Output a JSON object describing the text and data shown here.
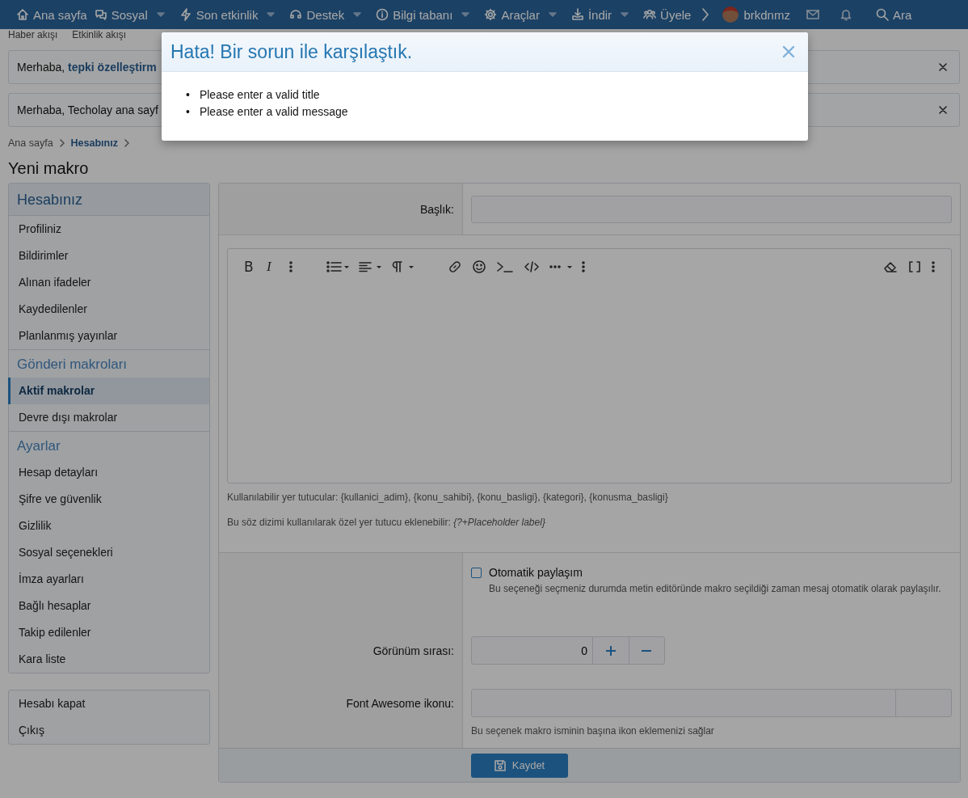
{
  "nav": {
    "items": [
      {
        "label": "Ana sayfa",
        "has_menu": false
      },
      {
        "label": "Sosyal",
        "has_menu": true
      },
      {
        "label": "Son etkinlik",
        "has_menu": true
      },
      {
        "label": "Destek",
        "has_menu": true
      },
      {
        "label": "Bilgi tabanı",
        "has_menu": true
      },
      {
        "label": "Araçlar",
        "has_menu": true
      },
      {
        "label": "İndir",
        "has_menu": true
      },
      {
        "label": "Üyele",
        "has_menu": false
      }
    ],
    "user": {
      "name": "brkdnmz"
    },
    "search": "Ara"
  },
  "subnav": [
    "Haber akışı",
    "Etkinlik akışı"
  ],
  "notices": [
    {
      "text": "Merhaba, **tepki özelleştirm**"
    },
    {
      "text": "Merhaba, Techolay ana sayf"
    }
  ],
  "breadcrumb": [
    {
      "label": "Ana sayfa",
      "current": false
    },
    {
      "label": "Hesabınız",
      "current": true
    }
  ],
  "page_title": "Yeni makro",
  "sidebar": {
    "sections": [
      {
        "title": "Hesabınız",
        "items": [
          {
            "label": "Profiliniz",
            "selected": false
          },
          {
            "label": "Bildirimler",
            "selected": false
          },
          {
            "label": "Alınan ifadeler",
            "selected": false
          },
          {
            "label": "Kaydedilenler",
            "selected": false
          },
          {
            "label": "Planlanmış yayınlar",
            "selected": false
          }
        ]
      },
      {
        "title": "Gönderi makroları",
        "items": [
          {
            "label": "Aktif makrolar",
            "selected": true
          },
          {
            "label": "Devre dışı makrolar",
            "selected": false
          }
        ]
      },
      {
        "title": "Ayarlar",
        "items": [
          {
            "label": "Hesap detayları",
            "selected": false
          },
          {
            "label": "Şifre ve güvenlik",
            "selected": false
          },
          {
            "label": "Gizlilik",
            "selected": false
          },
          {
            "label": "Sosyal seçenekleri",
            "selected": false
          },
          {
            "label": "İmza ayarları",
            "selected": false
          },
          {
            "label": "Bağlı hesaplar",
            "selected": false
          },
          {
            "label": "Takip edilenler",
            "selected": false
          },
          {
            "label": "Kara liste",
            "selected": false
          }
        ]
      }
    ],
    "footer_items": [
      {
        "label": "Hesabı kapat",
        "selected": false
      },
      {
        "label": "Çıkış",
        "selected": false
      }
    ]
  },
  "form": {
    "title_label": "Başlık:",
    "editor": {
      "bold": "B",
      "italic": "I"
    },
    "hints": [
      "Kullanılabilir yer tutucular: {kullanici_adim}, {konu_sahibi}, {konu_basligi}, {kategori}, {konusma_basligi}",
      "Bu söz dizimi kullanılarak özel yer tutucu eklenebilir: *{?+Placeholder label}*"
    ],
    "auto_share": {
      "label": "Otomatik paylaşım",
      "checked": false,
      "hint": "Bu seçeneği seçmeniz durumda metin editöründe makro seçildiği zaman mesaj otomatik olarak paylaşılır."
    },
    "order": {
      "label": "Görünüm sırası:",
      "value": "0"
    },
    "icon_field": {
      "label": "Font Awesome ikonu:",
      "hint": "Bu seçenek makro isminin başına ikon eklemenizi sağlar"
    },
    "save": "Kaydet"
  },
  "modal": {
    "title": "Hata! Bir sorun ile karşılaştık.",
    "errors": [
      {
        "marker": "•",
        "text": "Please enter a valid title"
      },
      {
        "marker": "•",
        "text": "Please enter a valid message"
      }
    ]
  }
}
